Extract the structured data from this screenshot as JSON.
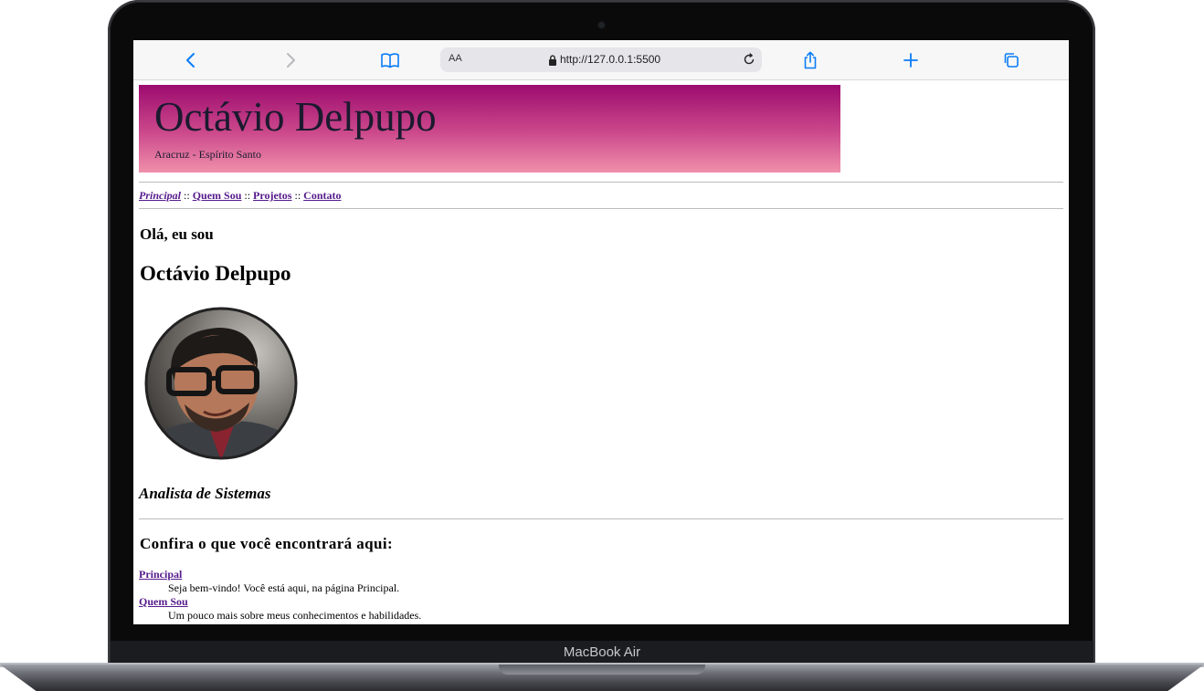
{
  "device": {
    "brand_label": "MacBook Air"
  },
  "browser": {
    "text_size_label": "AA",
    "url": "http://127.0.0.1:5500",
    "icons": [
      "back-icon",
      "forward-icon",
      "bookmarks-icon",
      "lock-icon",
      "reload-icon",
      "share-icon",
      "new-tab-icon",
      "tabs-icon"
    ],
    "accent_color": "#0a7cf7"
  },
  "header": {
    "title": "Octávio Delpupo",
    "location": "Aracruz - Espírito Santo",
    "gradient_colors": [
      "#9c0b6e",
      "#f090ab"
    ]
  },
  "nav": {
    "items": [
      {
        "label": "Principal",
        "current": true
      },
      {
        "label": "Quem Sou"
      },
      {
        "label": "Projetos"
      },
      {
        "label": "Contato"
      }
    ],
    "separator": "::"
  },
  "main": {
    "greeting": "Olá, eu sou",
    "name": "Octávio Delpupo",
    "role": "Analista de Sistemas",
    "sections_heading": "Confira o que você encontrará aqui:",
    "sections": [
      {
        "title": "Principal",
        "description": "Seja bem-vindo! Você está aqui, na página Principal."
      },
      {
        "title": "Quem Sou",
        "description": "Um pouco mais sobre meus conhecimentos e habilidades."
      }
    ]
  }
}
